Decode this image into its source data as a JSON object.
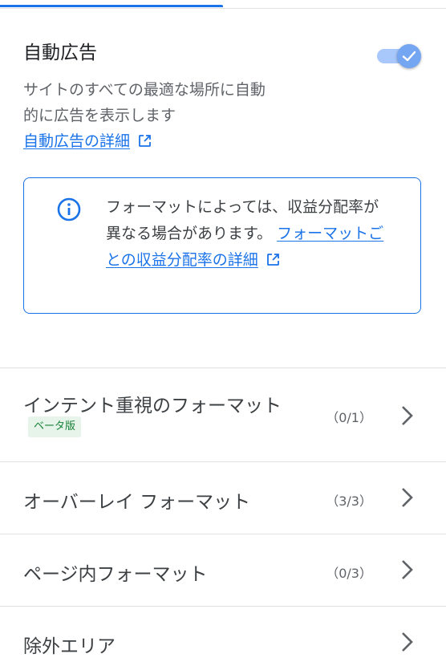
{
  "colors": {
    "accent": "#1a73e8",
    "toggle_track": "#a8c7fa",
    "toggle_knob": "#74a6f2",
    "badge_text": "#188038",
    "badge_bg": "#e6f4ea"
  },
  "auto_ads": {
    "title": "自動広告",
    "toggle_on": true,
    "description_line1": "サイトのすべての最適な場所に自動",
    "description_line2": "的に広告を表示します",
    "details_link": "自動広告の詳細"
  },
  "info": {
    "text": "フォーマットによっては、収益分配率が異なる場合があります。",
    "link": "フォーマットごとの収益分配率の詳細"
  },
  "list": [
    {
      "label": "インテント重視のフォーマット",
      "badge": "ベータ版",
      "count": "（0/1）"
    },
    {
      "label": "オーバーレイ フォーマット",
      "count": "（3/3）"
    },
    {
      "label": "ページ内フォーマット",
      "count": "（0/3）"
    },
    {
      "label": "除外エリア",
      "count": ""
    }
  ]
}
